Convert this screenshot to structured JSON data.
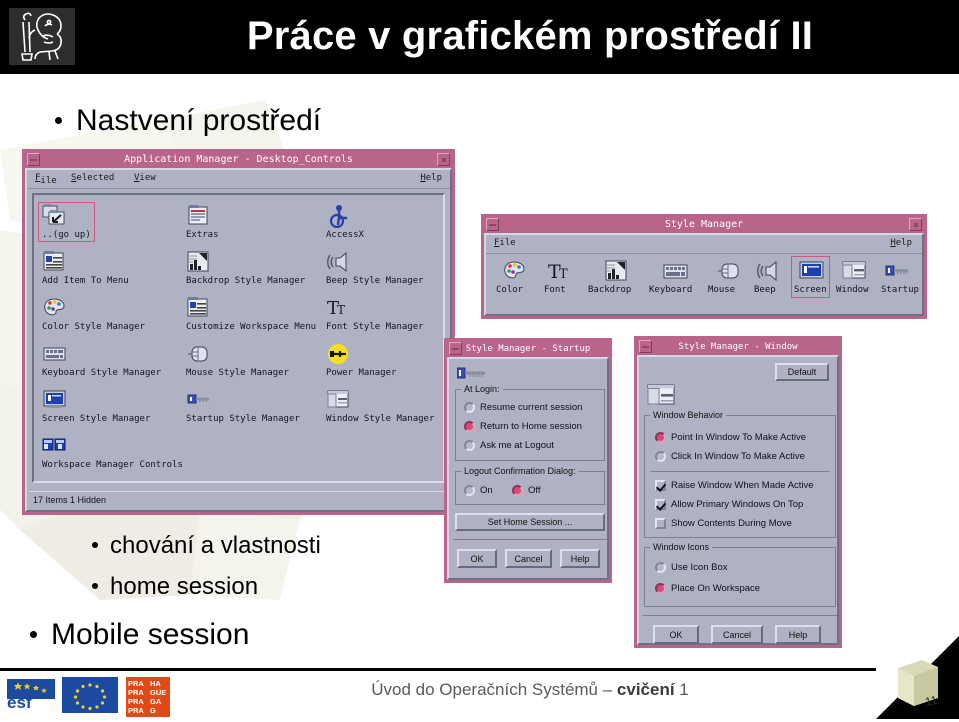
{
  "slide": {
    "title": "Práce v grafickém prostředí II",
    "logo_icon": "ctu-lion-logo",
    "bullets": [
      {
        "level": 1,
        "text": "Nastvení prostředí"
      },
      {
        "level": 2,
        "text": "chování a vlastnosti"
      },
      {
        "level": 2,
        "text": "home session"
      },
      {
        "level": 1,
        "text": "Mobile session"
      }
    ],
    "footer": {
      "text_plain_1": "Úvod do Operačních Systémů – ",
      "text_bold": "cvičení",
      "text_plain_2": " 1",
      "page_number": "11",
      "logos": [
        "esf-logo",
        "eu-flag-logo",
        "praha-prague-praga-prag-logo"
      ]
    }
  },
  "colors": {
    "titlebar": "#b9648a",
    "window_bg": "#aeb2c3",
    "accent_selected": "#cf4f80",
    "header_bg": "#000000"
  },
  "app_manager": {
    "title": "Application Manager - Desktop_Controls",
    "menus": [
      "File",
      "Selected",
      "View"
    ],
    "help_label": "Help",
    "status": "17 Items 1 Hidden",
    "items": [
      {
        "label": "..(go up)",
        "icon": "go-up-folder-icon",
        "selected": true
      },
      {
        "label": "Extras",
        "icon": "extras-folder-icon",
        "selected": false
      },
      {
        "label": "AccessX",
        "icon": "accessx-wheelchair-icon",
        "selected": false
      },
      {
        "label": "Add Item To Menu",
        "icon": "add-item-to-menu-icon",
        "selected": false
      },
      {
        "label": "Backdrop Style Manager",
        "icon": "backdrop-icon",
        "selected": false
      },
      {
        "label": "Beep Style Manager",
        "icon": "beep-speaker-icon",
        "selected": false
      },
      {
        "label": "Color Style Manager",
        "icon": "color-palette-icon",
        "selected": false
      },
      {
        "label": "Customize Workspace Menu",
        "icon": "customize-workspace-menu-icon",
        "selected": false
      },
      {
        "label": "Font Style Manager",
        "icon": "font-icon",
        "selected": false
      },
      {
        "label": "Keyboard Style Manager",
        "icon": "keyboard-icon",
        "selected": false
      },
      {
        "label": "Mouse Style Manager",
        "icon": "mouse-icon",
        "selected": false
      },
      {
        "label": "Power Manager",
        "icon": "power-plug-icon",
        "selected": false
      },
      {
        "label": "Screen Style Manager",
        "icon": "screen-icon",
        "selected": false
      },
      {
        "label": "Startup Style Manager",
        "icon": "startup-key-icon",
        "selected": false
      },
      {
        "label": "Window Style Manager",
        "icon": "window-icon",
        "selected": false
      },
      {
        "label": "Workspace Manager Controls",
        "icon": "workspace-manager-icon",
        "selected": false
      }
    ]
  },
  "style_manager": {
    "title": "Style Manager",
    "menus": [
      "File"
    ],
    "help_label": "Help",
    "toolbar": [
      {
        "label": "Color",
        "icon": "color-palette-icon",
        "selected": false
      },
      {
        "label": "Font",
        "icon": "font-icon",
        "selected": false
      },
      {
        "label": "Backdrop",
        "icon": "backdrop-icon",
        "selected": false
      },
      {
        "label": "Keyboard",
        "icon": "keyboard-icon",
        "selected": false
      },
      {
        "label": "Mouse",
        "icon": "mouse-icon",
        "selected": false
      },
      {
        "label": "Beep",
        "icon": "beep-speaker-icon",
        "selected": false
      },
      {
        "label": "Screen",
        "icon": "screen-icon",
        "selected": true
      },
      {
        "label": "Window",
        "icon": "window-icon",
        "selected": false
      },
      {
        "label": "Startup",
        "icon": "startup-key-icon",
        "selected": false
      }
    ]
  },
  "startup_dialog": {
    "title": "Style Manager - Startup",
    "icon": "startup-key-icon",
    "group_at_login": {
      "title": "At Login:",
      "options": [
        {
          "label": "Resume current session",
          "selected": false
        },
        {
          "label": "Return to Home session",
          "selected": true
        },
        {
          "label": "Ask me at Logout",
          "selected": false
        }
      ]
    },
    "group_logout": {
      "title": "Logout Confirmation Dialog:",
      "options": [
        {
          "label": "On",
          "selected": false
        },
        {
          "label": "Off",
          "selected": true
        }
      ]
    },
    "set_home_button": "Set Home Session ...",
    "buttons": [
      "OK",
      "Cancel",
      "Help"
    ]
  },
  "window_dialog": {
    "title": "Style Manager - Window",
    "icon": "window-icon",
    "default_button": "Default",
    "group_behavior": {
      "title": "Window Behavior",
      "radios": [
        {
          "label": "Point In Window To Make Active",
          "selected": true
        },
        {
          "label": "Click In Window To Make Active",
          "selected": false
        }
      ],
      "checks": [
        {
          "label": "Raise Window When Made Active",
          "checked": true
        },
        {
          "label": "Allow Primary Windows On Top",
          "checked": true
        },
        {
          "label": "Show Contents During Move",
          "checked": false
        }
      ]
    },
    "group_icons": {
      "title": "Window Icons",
      "radios": [
        {
          "label": "Use Icon Box",
          "selected": false
        },
        {
          "label": "Place On Workspace",
          "selected": true
        }
      ]
    },
    "buttons": [
      "OK",
      "Cancel",
      "Help"
    ]
  }
}
